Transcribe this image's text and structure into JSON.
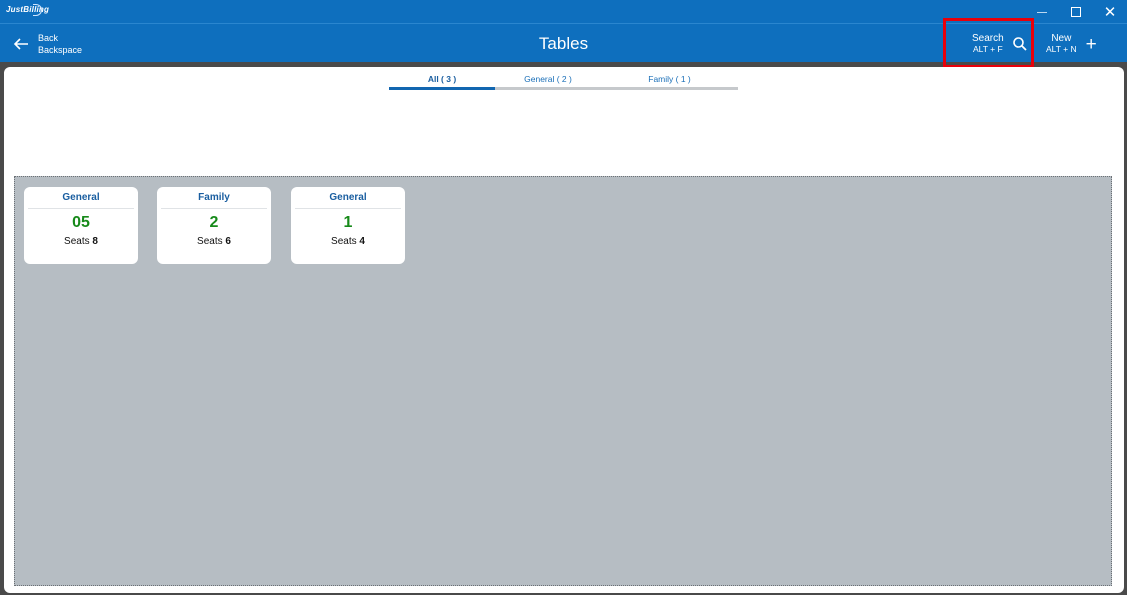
{
  "app": {
    "logo": "JustBilling"
  },
  "toolbar": {
    "back_label": "Back",
    "back_shortcut": "Backspace",
    "title": "Tables",
    "search_label": "Search",
    "search_shortcut": "ALT + F",
    "new_label": "New",
    "new_shortcut": "ALT + N"
  },
  "tabs": [
    {
      "label": "All ( 3 )",
      "active": true
    },
    {
      "label": "General ( 2 )",
      "active": false
    },
    {
      "label": "Family ( 1 )",
      "active": false
    }
  ],
  "tables": [
    {
      "type": "General",
      "number": "05",
      "seats_label": "Seats",
      "seats": "8"
    },
    {
      "type": "Family",
      "number": "2",
      "seats_label": "Seats",
      "seats": "6"
    },
    {
      "type": "General",
      "number": "1",
      "seats_label": "Seats",
      "seats": "4"
    }
  ],
  "colors": {
    "header": "#0e6fbe",
    "highlight": "#e8000b",
    "table_number": "#178a1a",
    "grid_background": "#b6bdc3"
  }
}
